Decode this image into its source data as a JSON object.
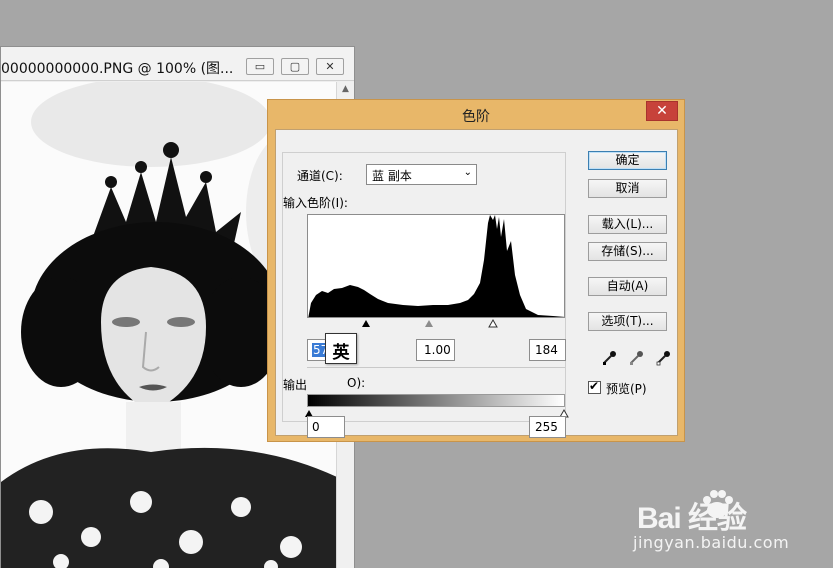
{
  "document_window": {
    "title": "00000000000.PNG @ 100% (图...",
    "buttons": {
      "minimize": "▭",
      "maximize": "▢",
      "close": "✕"
    }
  },
  "dialog": {
    "title": "色阶",
    "close_label": "✕",
    "channel_label": "通道(C):",
    "channel_value": "蓝 副本",
    "input_levels_label": "输入色阶(I):",
    "input_black": "57",
    "input_gamma": "1.00",
    "input_white": "184",
    "output_levels_label_start": "输出",
    "output_levels_label_end": "O):",
    "output_black": "0",
    "output_white": "255",
    "ime_tooltip": "英",
    "buttons": {
      "ok": "确定",
      "cancel": "取消",
      "load": "载入(L)...",
      "save": "存储(S)...",
      "auto": "自动(A)",
      "options": "选项(T)..."
    },
    "preview_label": "预览(P)",
    "preview_checked": "✔",
    "levels": {
      "input_black": 57,
      "input_gamma": 1.0,
      "input_white": 184,
      "output_black": 0,
      "output_white": 255
    }
  },
  "watermark": {
    "logo": "Bai  经验",
    "site": "jingyan.baidu.com"
  },
  "colors": {
    "desktop": "#a6a6a6",
    "dialog_frame": "#e8b769",
    "close_button": "#c7423a"
  }
}
